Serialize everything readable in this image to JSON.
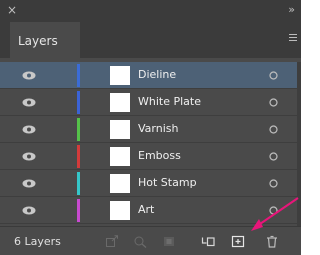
{
  "panel": {
    "tab_label": "Layers",
    "layer_count": "6 Layers"
  },
  "layers": [
    {
      "name": "Dieline",
      "color": "#3b6cd6",
      "selected": true
    },
    {
      "name": "White Plate",
      "color": "#3b63d6",
      "selected": false
    },
    {
      "name": "Varnish",
      "color": "#55c24a",
      "selected": false
    },
    {
      "name": "Emboss",
      "color": "#d33b3b",
      "selected": false
    },
    {
      "name": "Hot Stamp",
      "color": "#35c6c9",
      "selected": false
    },
    {
      "name": "Art",
      "color": "#c84ad0",
      "selected": false
    }
  ],
  "footer_icons": [
    "export-icon",
    "locate-object-icon",
    "make-clipping-mask-icon",
    "create-sublayer-icon",
    "new-layer-icon",
    "delete-layer-icon"
  ],
  "annotation": {
    "color": "#e8157a"
  }
}
